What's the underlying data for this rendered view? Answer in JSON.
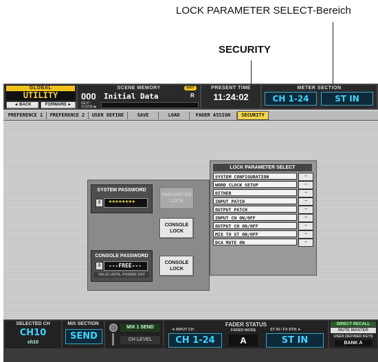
{
  "annotations": {
    "lock_parameter_select_area": "LOCK PARAMETER SELECT-Bereich",
    "security": "SECURITY"
  },
  "header": {
    "global_label": "GLOBAL",
    "function_name": "UTILITY",
    "back_label": "◄ BACK",
    "forward_label": "FORWARD ►",
    "scene_memory_label": "SCENE MEMORY",
    "edit_badge": "EDIT",
    "scene_number": "000",
    "scene_title": "Initial Data",
    "scene_flag": "R",
    "next_scene_label": "NEXT SCENE ▶",
    "present_time_label": "PRESENT TIME",
    "present_time": "11:24:02",
    "meter_section_label": "METER SECTION",
    "meter_channel": "CH 1-24",
    "meter_stereo": "ST IN"
  },
  "tabs": [
    {
      "label": "PREFERENCE 1"
    },
    {
      "label": "PREFERENCE 2"
    },
    {
      "label": "USER DEFINE"
    },
    {
      "label": "SAVE"
    },
    {
      "label": "LOAD"
    },
    {
      "label": "FADER ASSIGN"
    },
    {
      "label": "SECURITY"
    }
  ],
  "security": {
    "system_password_label": "SYSTEM PASSWORD",
    "system_password_value": "********",
    "parameter_lock_label": "PARAMETER LOCK",
    "console_lock_label": "CONSOLE LOCK",
    "console_password_label": "CONSOLE PASSWORD",
    "console_password_value": "---FREE---",
    "valid_until_label": "VALID UNTIL POWER OFF",
    "console_lock2_label": "CONSOLE LOCK",
    "lock_parameter_select_title": "LOCK PARAMETER SELECT",
    "lock_items": [
      {
        "label": "SYSTEM CONFIGURATION",
        "button": "−"
      },
      {
        "label": "WORD CLOCK SETUP",
        "button": "−"
      },
      {
        "label": "DITHER",
        "button": "−"
      },
      {
        "label": "INPUT PATCH",
        "button": "−"
      },
      {
        "label": "OUTPUT PATCH",
        "button": "−"
      },
      {
        "label": "INPUT CH ON/OFF",
        "button": "−"
      },
      {
        "label": "OUTPUT CH ON/OFF",
        "button": "−"
      },
      {
        "label": "MIX TO ST ON/OFF",
        "button": "−"
      },
      {
        "label": "DCA MUTE ON",
        "button": "−"
      }
    ]
  },
  "footer": {
    "selected_ch_label": "SELECTED CH",
    "selected_ch_value": "CH10",
    "selected_ch_name": "ch10",
    "mix_section_label": "MIX SECTION",
    "mix_section_value": "SEND",
    "mix_send_label": "MIX 1 SEND",
    "ch_level_label": "CH LEVEL",
    "fader_status_label": "FADER STATUS",
    "input_ch_label": "◄ INPUT CH",
    "input_ch_value": "CH 1-24",
    "fader_mode_label": "FADER MODE",
    "fader_mode_value": "A",
    "st_in_fx_rtn_label": "ST IN / FX RTN ►",
    "st_in_value": "ST IN",
    "direct_recall_label": "DIRECT RECALL",
    "mute_master_label": "MUTE MASTER",
    "user_defined_keys_label": "USER DEFINED KEYS",
    "bank_value": "BANK A"
  }
}
